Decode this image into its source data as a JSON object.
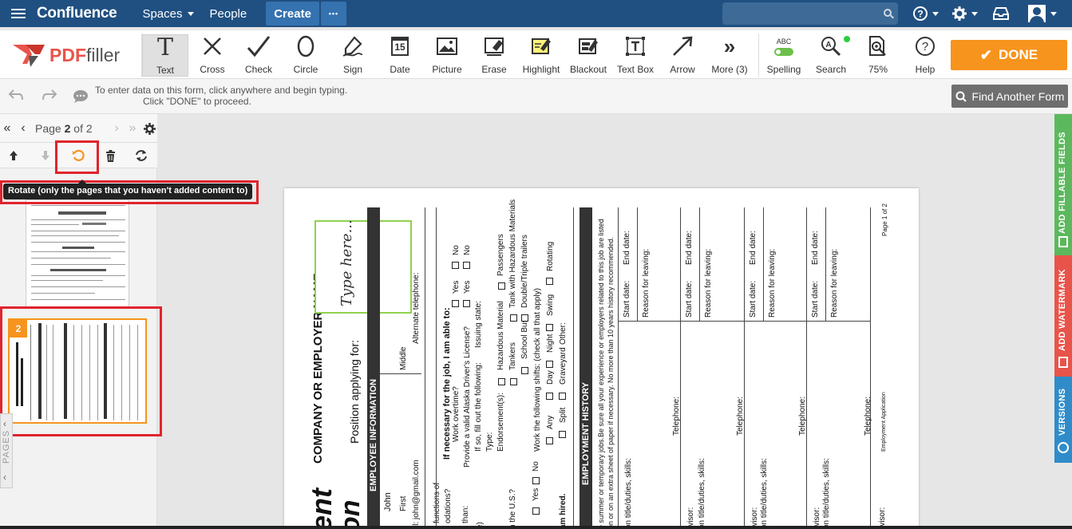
{
  "confluence": {
    "logo": "Confluence",
    "nav": {
      "spaces": "Spaces",
      "people": "People",
      "create": "Create",
      "more": "•••"
    }
  },
  "toolbar": {
    "tools": [
      {
        "label": "Text",
        "icon": "text-icon"
      },
      {
        "label": "Cross",
        "icon": "cross-icon"
      },
      {
        "label": "Check",
        "icon": "check-icon"
      },
      {
        "label": "Circle",
        "icon": "circle-icon"
      },
      {
        "label": "Sign",
        "icon": "sign-icon"
      },
      {
        "label": "Date",
        "icon": "date-icon"
      },
      {
        "label": "Picture",
        "icon": "picture-icon"
      },
      {
        "label": "Erase",
        "icon": "erase-icon"
      },
      {
        "label": "Highlight",
        "icon": "highlight-icon"
      },
      {
        "label": "Blackout",
        "icon": "blackout-icon"
      },
      {
        "label": "Text Box",
        "icon": "textbox-icon"
      },
      {
        "label": "Arrow",
        "icon": "arrow-icon"
      },
      {
        "label": "More (3)",
        "icon": "more-icon"
      },
      {
        "label": "Spelling",
        "icon": "spelling-icon"
      },
      {
        "label": "Search",
        "icon": "search-icon"
      },
      {
        "label": "75%",
        "icon": "zoom-icon"
      },
      {
        "label": "Help",
        "icon": "help-icon"
      }
    ],
    "date_icon_text": "15",
    "spelling_icon_text": "ABC",
    "done": "DONE",
    "brand_pdf": "PDF",
    "brand_filler": "filler",
    "accent": "#f7941d"
  },
  "info": {
    "line1": "To enter data on this form, click anywhere and begin typing.",
    "line2": "Click \"DONE\" to proceed.",
    "find_another": "Find Another Form"
  },
  "pager": {
    "prefix": "Page ",
    "current": "2",
    "suffix": " of 2",
    "tooltip": "Rotate (only the pages that you haven't added content to)",
    "thumb_badge": "2",
    "pages_tab": "PAGES"
  },
  "side_tabs": {
    "fillable": "ADD FILLABLE FIELDS",
    "watermark": "ADD WATERMARK",
    "versions": "VERSIONS"
  },
  "document": {
    "type_here": "Type here...",
    "company": "COMPANY OR EMPLOYER NAME",
    "position": "Position applying for:",
    "emp_info": "EMPLOYEE INFORMATION",
    "john": "John",
    "first": "First",
    "middle": "Middle",
    "email": "il:  john@gmail.com",
    "alt_phone": "Alternate telephone:",
    "functions": "functions of",
    "odations": "odations?",
    "than": "than:",
    "paren": "e)",
    "in_us": "n the U.S.?",
    "yes": "Yes",
    "no": "No",
    "am_hired": "am hired.",
    "if_necessary": "If necessary for the job, I am able to:",
    "work_overtime": "Work overtime?",
    "provide_license": "Provide a valid Alaska Driver's License?",
    "if_so": "If so, fill out the following:",
    "issuing": "Issuing state:",
    "type": "Type:",
    "endorsements": "Endorsement(s):",
    "hazmat": "Hazardous Material",
    "passengers": "Passengers",
    "tankers": "Tankers",
    "tank_hazmat": "Tank with Hazardous Materials",
    "school_bus": "School Bus",
    "double_triple": "Double/Triple trailers",
    "work_shifts": "Work the following shifts: (check all that apply)",
    "any": "Any",
    "day": "Day",
    "night": "Night",
    "swing": "Swing",
    "rotating": "Rotating",
    "split": "Split",
    "graveyard": "Graveyard",
    "other": "Other:",
    "emp_history": "EMPLOYMENT HISTORY",
    "hist_note1": "e summer or temporary jobs.Be sure all your experience or employers related to this job are listed",
    "hist_note2": "on or on an extra sheet of paper if necessary. No more than 10 years history recommended.",
    "start_date": "Start date:",
    "end_date": "End date:",
    "reason": "Reason for leaving:",
    "telephone": "Telephone:",
    "on_title": "on title/duties, skills:",
    "supervisor": "rvisor:",
    "page_of": "Page 1 of 2",
    "emp_app": "Employment Application",
    "big_ent": "ent",
    "big_on": "on"
  }
}
